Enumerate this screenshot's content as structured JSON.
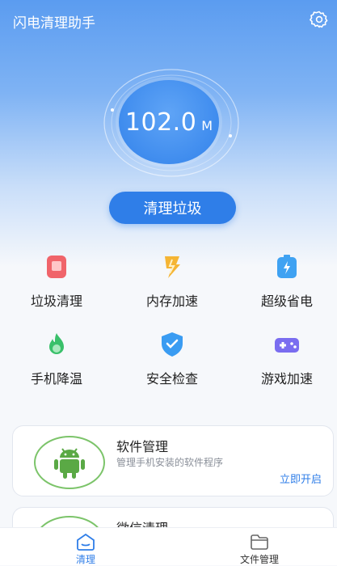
{
  "app": {
    "title": "闪电清理助手"
  },
  "gauge": {
    "value": "102.0",
    "unit": "M"
  },
  "clean_button": "清理垃圾",
  "features": [
    {
      "label": "垃圾清理",
      "icon": "trash-phone-icon",
      "color": "#f0646a"
    },
    {
      "label": "内存加速",
      "icon": "lightning-icon",
      "color": "#f5b534"
    },
    {
      "label": "超级省电",
      "icon": "battery-icon",
      "color": "#3fa2f2"
    },
    {
      "label": "手机降温",
      "icon": "flame-icon",
      "color": "#39c06a"
    },
    {
      "label": "安全检查",
      "icon": "shield-icon",
      "color": "#3a9cf2"
    },
    {
      "label": "游戏加速",
      "icon": "gamepad-icon",
      "color": "#7a6df0"
    }
  ],
  "cards": [
    {
      "title": "软件管理",
      "subtitle": "管理手机安装的软件程序",
      "action": "立即开启"
    },
    {
      "title": "微信清理"
    }
  ],
  "tabs": [
    {
      "label": "清理",
      "active": true
    },
    {
      "label": "文件管理",
      "active": false
    }
  ],
  "colors": {
    "accent": "#2f7ee8",
    "green": "#7cc46a"
  }
}
